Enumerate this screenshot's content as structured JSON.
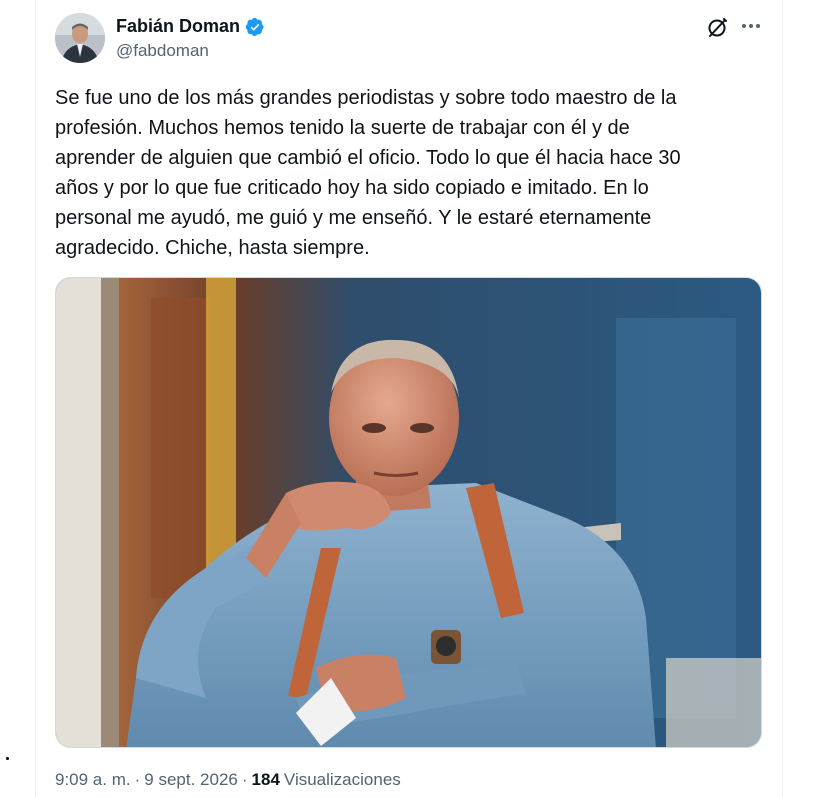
{
  "tweet": {
    "author_name": "Fabián Doman",
    "author_handle": "@fabdoman",
    "verified": true,
    "text": "Se fue uno de los más grandes periodistas y sobre todo maestro de la\nprofesión. Muchos hemos tenido la suerte de trabajar con él y de\naprender de alguien que cambió el oficio. Todo lo que él hacia hace 30\naños y por lo que fue criticado hoy ha sido copiado e imitado. En lo\npersonal me ayudó, me guió y me enseñó. Y le estaré eternamente\nagradecido. Chiche, hasta siempre.",
    "time": "9:09 a. m.",
    "separator": "·",
    "date": "9 sept. 2026",
    "views_count": "184",
    "views_label": "Visualizaciones"
  },
  "icons": {
    "verified": "verified-badge-icon",
    "grok": "grok-icon",
    "more": "more-icon"
  },
  "colors": {
    "text": "#0f1419",
    "secondary": "#536471",
    "verified_blue": "#1d9bf0",
    "border": "#eff3f4"
  }
}
